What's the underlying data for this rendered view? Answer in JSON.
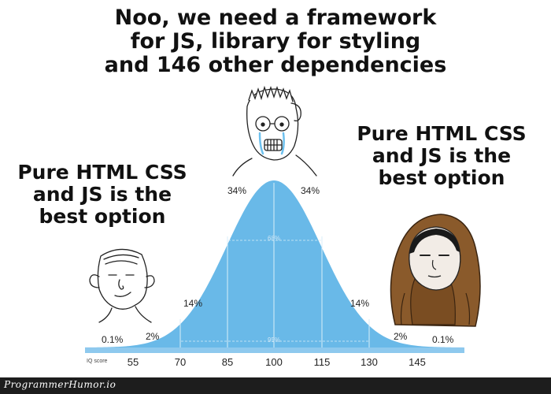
{
  "captions": {
    "top": "Noo, we need a framework\nfor JS, library for styling\nand 146 other dependencies",
    "left": "Pure HTML CSS\nand JS is the\nbest option",
    "right": "Pure HTML CSS\nand JS is the\nbest option"
  },
  "chart": {
    "percentages": {
      "far_left": "0.1%",
      "left_tail": "2%",
      "left_mid": "14%",
      "left_center": "34%",
      "right_center": "34%",
      "right_mid": "14%",
      "right_tail": "2%",
      "far_right": "0.1%",
      "inner_68": "68%",
      "inner_95": "95%"
    },
    "axis_label": "IQ score",
    "ticks": [
      "55",
      "70",
      "85",
      "100",
      "115",
      "130",
      "145"
    ],
    "colors": {
      "curve": "#69b9e8",
      "baseline": "#8ec9ee"
    }
  },
  "characters": {
    "left": "wojak-smirk",
    "center": "wojak-crying-glasses",
    "right": "hooded-monk"
  },
  "watermark": "ProgrammerHumor.io"
}
